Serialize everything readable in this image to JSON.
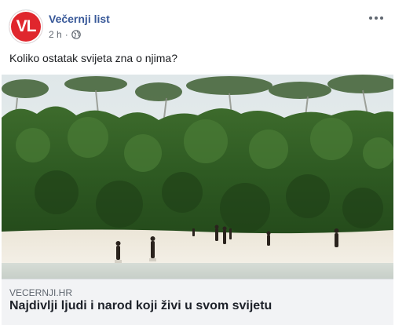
{
  "post": {
    "page_name": "Večernji list",
    "avatar_text": "VL",
    "timestamp": "2 h",
    "separator": "·",
    "message": "Koliko ostatak svijeta zna o njima?",
    "privacy_icon": "globe-icon",
    "menu_icon": "more-options-icon"
  },
  "link": {
    "domain": "VECERNJI.HR",
    "title": "Najdivlji ljudi i narod koji živi u svom svijetu"
  },
  "colors": {
    "brand_red": "#e0262d",
    "page_name_blue": "#385898",
    "link_footer_bg": "#f2f3f5"
  }
}
